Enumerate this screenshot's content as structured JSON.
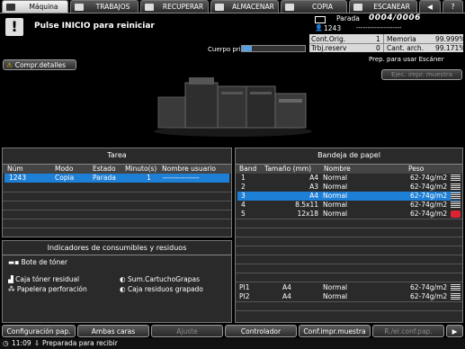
{
  "tabs": [
    {
      "label": "Máquina",
      "active": true
    },
    {
      "label": "TRABAJOS",
      "active": false
    },
    {
      "label": "RECUPERAR",
      "active": false
    },
    {
      "label": "ALMACENAR",
      "active": false
    },
    {
      "label": "COPIA",
      "active": false
    },
    {
      "label": "ESCANEAR",
      "active": false
    }
  ],
  "status": {
    "message": "Pulse INICIO para reiniciar",
    "state": "Parada",
    "counter": "0004/0006",
    "job_number": "1243",
    "job_dashes": "--------------------",
    "body_label": "Cuerpo prin.",
    "cont_orig_label": "Cont.Orig.",
    "cont_orig_value": "1",
    "memoria_label": "Memoria",
    "memoria_value": "99.999%",
    "trbj_label": "Trbj.reserv",
    "trbj_value": "0",
    "cant_label": "Cant. arch.",
    "cant_value": "99.171%",
    "scanner_text": "Prep. para usar Escáner",
    "ejec_label": "Ejec. impr. muestra"
  },
  "compr_detalles": "Compr.detalles",
  "tarea": {
    "title": "Tarea",
    "headers": [
      "Núm",
      "Modo",
      "Estado",
      "Minuto(s)",
      "Nombre usuario"
    ],
    "rows": [
      [
        "1243",
        "Copia",
        "Parada",
        "1",
        "---------------"
      ]
    ]
  },
  "indicadores": {
    "title": "Indicadores de consumibles y residuos",
    "items": [
      "Bote de tóner",
      "Caja tóner residual",
      "Papelera perforación",
      "Sum.CartuchoGrapas",
      "Caja residuos grapado"
    ]
  },
  "bandeja": {
    "title": "Bandeja de papel",
    "headers": [
      "Band",
      "Tamaño (mm)",
      "Nombre",
      "Peso"
    ],
    "rows": [
      {
        "band": "1",
        "size": "A4",
        "name": "Normal",
        "weight": "62-74g/m2",
        "selected": false
      },
      {
        "band": "2",
        "size": "A3",
        "name": "Normal",
        "weight": "62-74g/m2",
        "selected": false
      },
      {
        "band": "3",
        "size": "A4",
        "name": "Normal",
        "weight": "62-74g/m2",
        "selected": true
      },
      {
        "band": "4",
        "size": "8.5x11",
        "name": "Normal",
        "weight": "62-74g/m2",
        "selected": false
      },
      {
        "band": "5",
        "size": "12x18",
        "name": "Normal",
        "weight": "62-74g/m2",
        "selected": false
      }
    ],
    "pi_rows": [
      {
        "band": "PI1",
        "size": "A4",
        "name": "Normal",
        "weight": "62-74g/m2"
      },
      {
        "band": "PI2",
        "size": "A4",
        "name": "Normal",
        "weight": "62-74g/m2"
      }
    ]
  },
  "bottom_buttons": [
    "Configuración pap.",
    "Ambas caras",
    "Ajuste",
    "Controlador",
    "Conf.impr.muestra",
    "R./el.conf.pap."
  ],
  "footer": {
    "time": "11:09",
    "status": "Preparada para recibir"
  }
}
